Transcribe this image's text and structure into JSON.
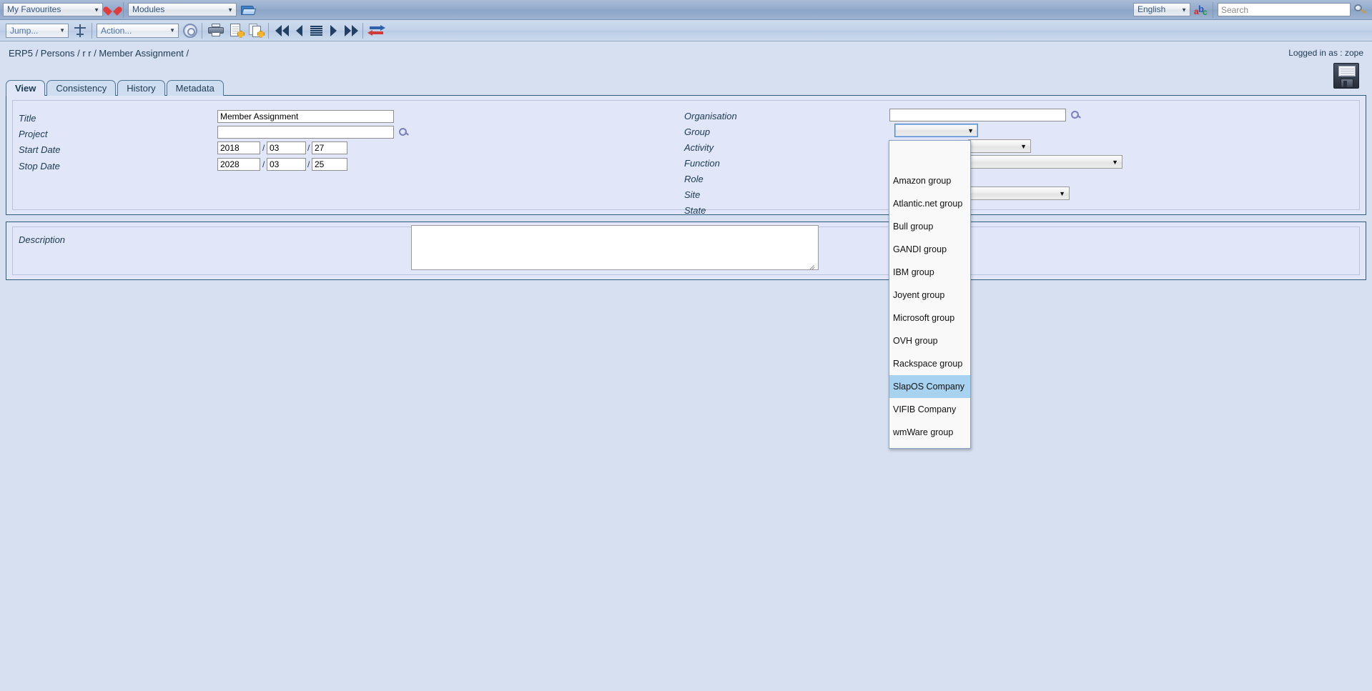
{
  "topbar": {
    "favourites_label": "My Favourites",
    "favourites_icon": "heart-icon",
    "modules_label": "Modules",
    "modules_icon": "open-folder-icon",
    "language_label": "English",
    "language_icon": "abc-translate-icon",
    "search_placeholder": "Search",
    "search_value": "",
    "search_icon": "magnifier-icon"
  },
  "actionbar": {
    "jump_label": "Jump...",
    "jump_icon": "airplane-icon",
    "action_label": "Action...",
    "action_icon": "gear-icon",
    "print_icon": "printer-icon",
    "new_document_icon": "new-document-icon",
    "clone_document_icon": "clone-document-icon",
    "first_icon": "first-page-icon",
    "previous_icon": "previous-page-icon",
    "list_icon": "list-view-icon",
    "next_icon": "next-page-icon",
    "last_icon": "last-page-icon",
    "exchange_icon": "exchange-icon"
  },
  "breadcrumb": {
    "path": "ERP5 / Persons / r r / Member Assignment /",
    "logged_in": "Logged in as : zope"
  },
  "tabs": [
    {
      "label": "View",
      "active": true
    },
    {
      "label": "Consistency",
      "active": false
    },
    {
      "label": "History",
      "active": false
    },
    {
      "label": "Metadata",
      "active": false
    }
  ],
  "save": {
    "icon": "floppy-save-icon",
    "title": "Save"
  },
  "form": {
    "left": {
      "title": {
        "label": "Title",
        "value": "Member Assignment"
      },
      "project": {
        "label": "Project",
        "value": "",
        "relation_icon": "relation-field-icon"
      },
      "start_date": {
        "label": "Start Date",
        "year": "2018",
        "month": "03",
        "day": "27",
        "sep": "/"
      },
      "stop_date": {
        "label": "Stop Date",
        "year": "2028",
        "month": "03",
        "day": "25",
        "sep": "/"
      }
    },
    "right": {
      "organisation": {
        "label": "Organisation",
        "value": "",
        "relation_icon": "relation-field-icon"
      },
      "group": {
        "label": "Group",
        "value": "",
        "open": true
      },
      "activity": {
        "label": "Activity",
        "value": ""
      },
      "function": {
        "label": "Function",
        "value": ""
      },
      "role": {
        "label": "Role",
        "value": ""
      },
      "site": {
        "label": "Site",
        "value": ""
      },
      "state": {
        "label": "State",
        "value": ""
      }
    },
    "description": {
      "label": "Description",
      "value": "",
      "placeholder": ""
    }
  },
  "group_dropdown": {
    "selected": "SlapOS Company",
    "options": [
      {
        "label": "",
        "selected": false
      },
      {
        "label": "Amazon group",
        "selected": false
      },
      {
        "label": "Atlantic.net group",
        "selected": false
      },
      {
        "label": "Bull group",
        "selected": false
      },
      {
        "label": "GANDI group",
        "selected": false
      },
      {
        "label": "IBM group",
        "selected": false
      },
      {
        "label": "Joyent group",
        "selected": false
      },
      {
        "label": "Microsoft group",
        "selected": false
      },
      {
        "label": "OVH group",
        "selected": false
      },
      {
        "label": "Rackspace group",
        "selected": false
      },
      {
        "label": "SlapOS Company",
        "selected": true
      },
      {
        "label": "VIFIB Company",
        "selected": false
      },
      {
        "label": "wmWare group",
        "selected": false
      }
    ]
  },
  "colors": {
    "page_bg": "#d7e0f1",
    "panel_bg": "#e1e6f8",
    "panel_border": "#2f5c7d",
    "topbar_bg": "#94abca",
    "actionbar_bg": "#c2d2e8",
    "tab_active_bg": "#dfe7f8",
    "tab_bg": "#cfddf0",
    "text": "#1c3a52",
    "highlight": "#a8d3f0"
  }
}
